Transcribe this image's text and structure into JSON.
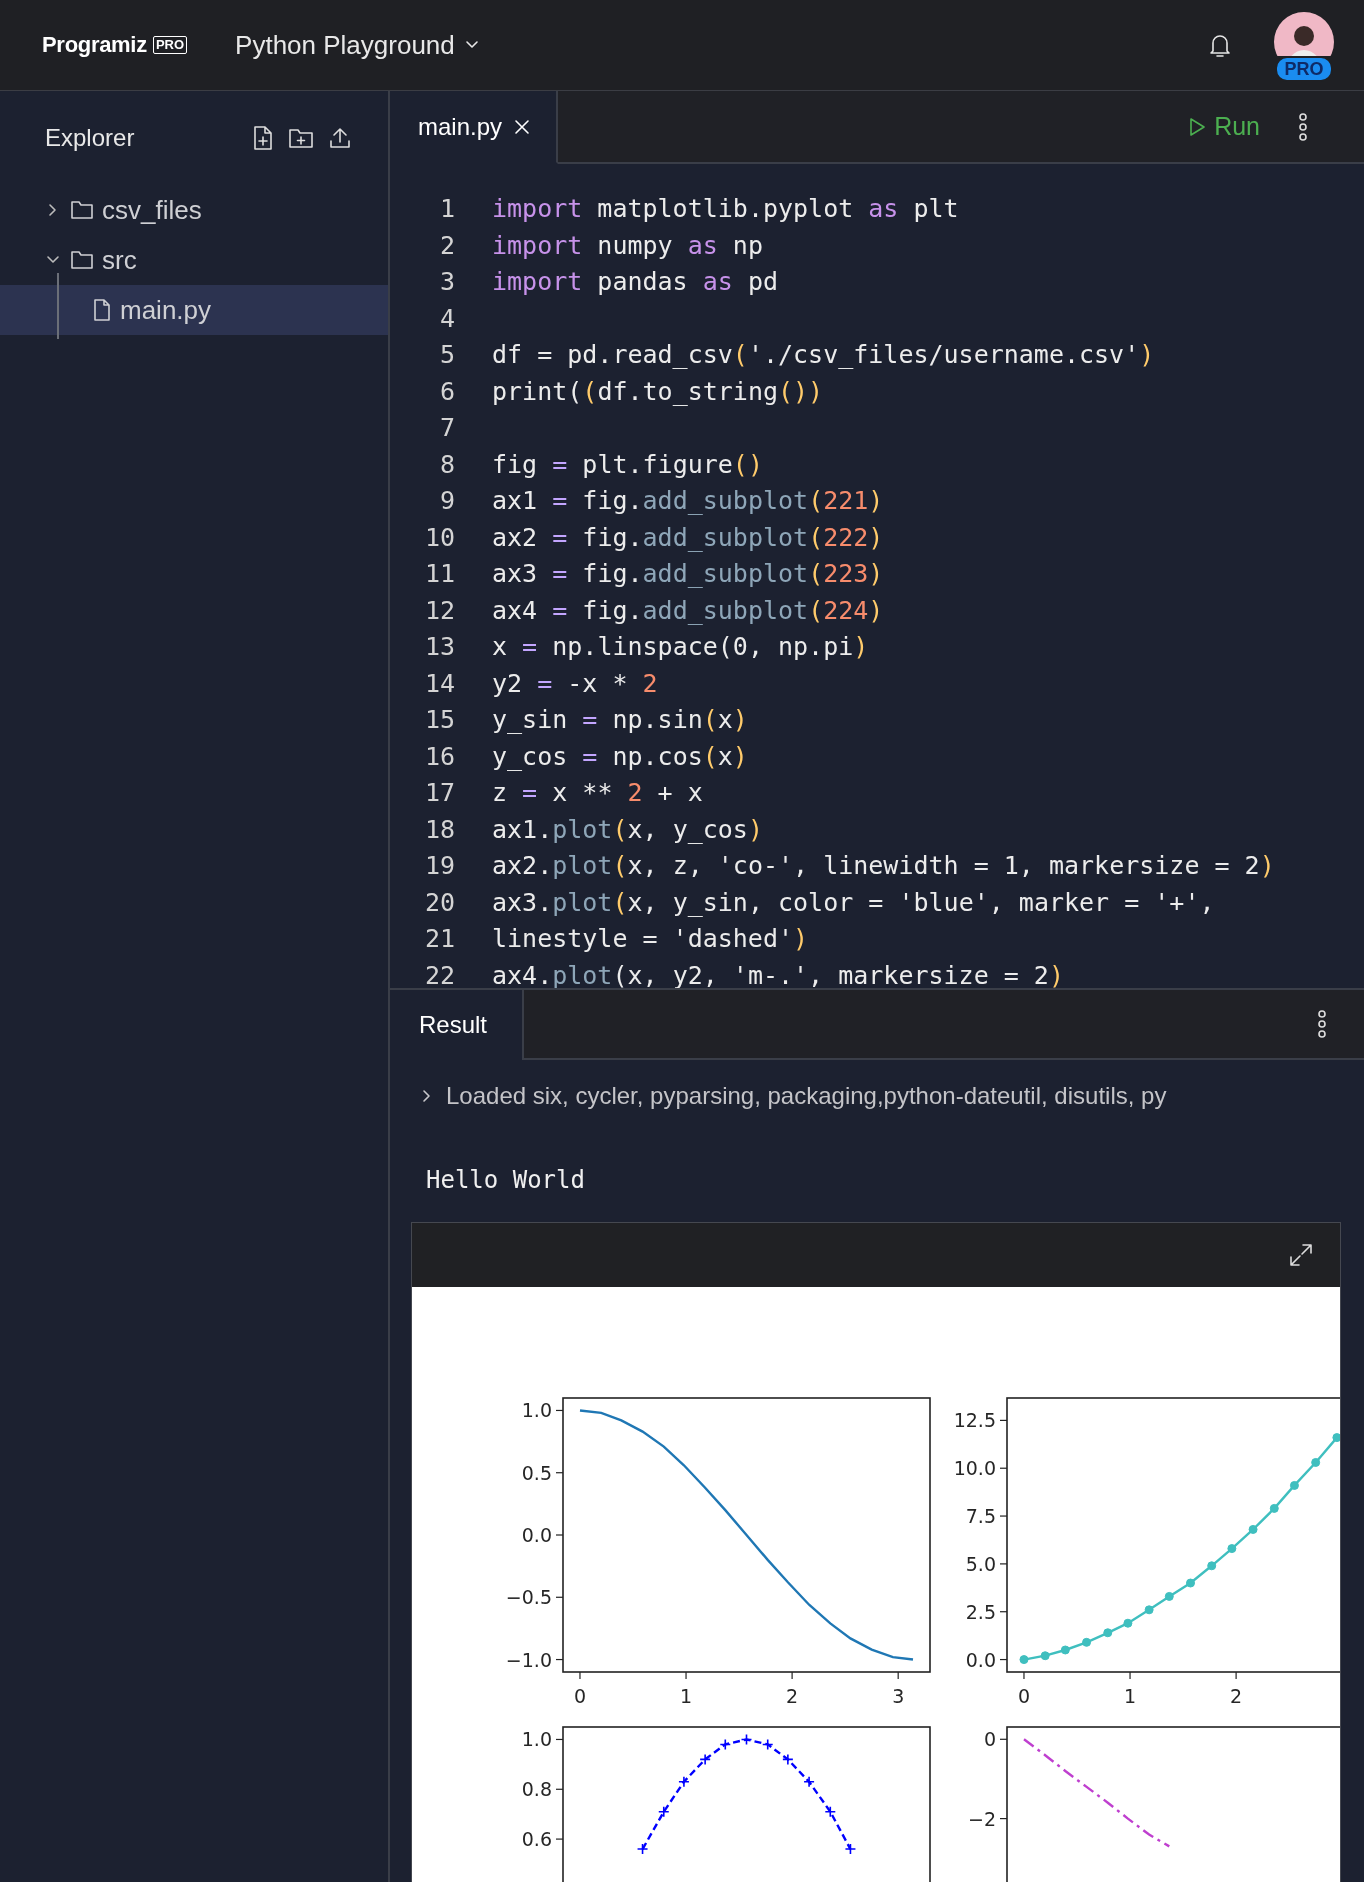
{
  "header": {
    "logo": "Programiz",
    "logo_badge": "PRO",
    "title": "Python Playground",
    "avatar_badge": "PRO"
  },
  "explorer": {
    "title": "Explorer",
    "tree": [
      {
        "name": "csv_files",
        "kind": "folder",
        "expanded": false,
        "selected": false
      },
      {
        "name": "src",
        "kind": "folder",
        "expanded": true,
        "selected": false,
        "children": [
          {
            "name": "main.py",
            "kind": "file",
            "selected": true
          }
        ]
      }
    ]
  },
  "editor": {
    "tabs": [
      {
        "label": "main.py",
        "selected": true
      }
    ],
    "run_label": "Run",
    "lines": [
      {
        "number": "1",
        "tokens": [
          {
            "kind": "kw",
            "text": "import"
          },
          {
            "kind": "plain",
            "text": " matplotlib.pyplot "
          },
          {
            "kind": "kw",
            "text": "as"
          },
          {
            "kind": "plain",
            "text": " plt"
          }
        ]
      },
      {
        "number": "2",
        "tokens": [
          {
            "kind": "kw",
            "text": "import"
          },
          {
            "kind": "plain",
            "text": " numpy "
          },
          {
            "kind": "kw",
            "text": "as"
          },
          {
            "kind": "plain",
            "text": " np"
          }
        ]
      },
      {
        "number": "3",
        "tokens": [
          {
            "kind": "kw",
            "text": "import"
          },
          {
            "kind": "plain",
            "text": " pandas "
          },
          {
            "kind": "kw",
            "text": "as"
          },
          {
            "kind": "plain",
            "text": " pd"
          }
        ]
      },
      {
        "number": "4"
      },
      {
        "number": "5",
        "tokens": [
          {
            "kind": "plain",
            "text": "df = pd.read_csv"
          },
          {
            "kind": "paren",
            "text": "("
          },
          {
            "kind": "plain",
            "text": "'./csv_files/username.csv'"
          },
          {
            "kind": "paren",
            "text": ")"
          }
        ]
      },
      {
        "number": "6",
        "tokens": [
          {
            "kind": "plain",
            "text": "print("
          },
          {
            "kind": "paren",
            "text": "("
          },
          {
            "kind": "plain",
            "text": "df.to_string"
          },
          {
            "kind": "paren",
            "text": "())"
          }
        ]
      },
      {
        "number": "7"
      },
      {
        "number": "8",
        "tokens": [
          {
            "kind": "plain",
            "text": "fig "
          },
          {
            "kind": "op",
            "text": "="
          },
          {
            "kind": "plain",
            "text": " plt.figure"
          },
          {
            "kind": "paren",
            "text": "()"
          }
        ]
      },
      {
        "number": "9",
        "tokens": [
          {
            "kind": "plain",
            "text": "ax1 "
          },
          {
            "kind": "op",
            "text": "="
          },
          {
            "kind": "plain",
            "text": " fig."
          },
          {
            "kind": "fn",
            "text": "add_subplot"
          },
          {
            "kind": "paren",
            "text": "("
          },
          {
            "kind": "num",
            "text": "221"
          },
          {
            "kind": "paren",
            "text": ")"
          }
        ]
      },
      {
        "number": "10",
        "tokens": [
          {
            "kind": "plain",
            "text": "ax2 "
          },
          {
            "kind": "op",
            "text": "="
          },
          {
            "kind": "plain",
            "text": " fig."
          },
          {
            "kind": "fn",
            "text": "add_subplot"
          },
          {
            "kind": "paren",
            "text": "("
          },
          {
            "kind": "num",
            "text": "222"
          },
          {
            "kind": "paren",
            "text": ")"
          }
        ]
      },
      {
        "number": "11",
        "tokens": [
          {
            "kind": "plain",
            "text": "ax3 "
          },
          {
            "kind": "op",
            "text": "="
          },
          {
            "kind": "plain",
            "text": " fig."
          },
          {
            "kind": "fn",
            "text": "add_subplot"
          },
          {
            "kind": "paren",
            "text": "("
          },
          {
            "kind": "num",
            "text": "223"
          },
          {
            "kind": "paren",
            "text": ")"
          }
        ]
      },
      {
        "number": "12",
        "tokens": [
          {
            "kind": "plain",
            "text": "ax4 "
          },
          {
            "kind": "op",
            "text": "="
          },
          {
            "kind": "plain",
            "text": " fig."
          },
          {
            "kind": "fn",
            "text": "add_subplot"
          },
          {
            "kind": "paren",
            "text": "("
          },
          {
            "kind": "num",
            "text": "224"
          },
          {
            "kind": "paren",
            "text": ")"
          }
        ]
      },
      {
        "number": "13",
        "tokens": [
          {
            "kind": "plain",
            "text": "x "
          },
          {
            "kind": "op",
            "text": "="
          },
          {
            "kind": "plain",
            "text": " np.linspace(0, np.pi"
          },
          {
            "kind": "paren",
            "text": ")"
          }
        ]
      },
      {
        "number": "14",
        "tokens": [
          {
            "kind": "plain",
            "text": "y2 "
          },
          {
            "kind": "op",
            "text": "="
          },
          {
            "kind": "plain",
            "text": " -x * "
          },
          {
            "kind": "num",
            "text": "2"
          }
        ]
      },
      {
        "number": "15",
        "tokens": [
          {
            "kind": "plain",
            "text": "y_sin "
          },
          {
            "kind": "op",
            "text": "="
          },
          {
            "kind": "plain",
            "text": " np.sin"
          },
          {
            "kind": "paren",
            "text": "("
          },
          {
            "kind": "plain",
            "text": "x"
          },
          {
            "kind": "paren",
            "text": ")"
          }
        ]
      },
      {
        "number": "16",
        "tokens": [
          {
            "kind": "plain",
            "text": "y_cos "
          },
          {
            "kind": "op",
            "text": "="
          },
          {
            "kind": "plain",
            "text": " np.cos"
          },
          {
            "kind": "paren",
            "text": "("
          },
          {
            "kind": "plain",
            "text": "x"
          },
          {
            "kind": "paren",
            "text": ")"
          }
        ]
      },
      {
        "number": "17",
        "tokens": [
          {
            "kind": "plain",
            "text": "z "
          },
          {
            "kind": "op",
            "text": "="
          },
          {
            "kind": "plain",
            "text": " x ** "
          },
          {
            "kind": "num",
            "text": "2"
          },
          {
            "kind": "plain",
            "text": " + x"
          }
        ]
      },
      {
        "number": "18",
        "tokens": [
          {
            "kind": "plain",
            "text": "ax1."
          },
          {
            "kind": "fn",
            "text": "plot"
          },
          {
            "kind": "paren",
            "text": "("
          },
          {
            "kind": "plain",
            "text": "x, y_cos"
          },
          {
            "kind": "paren",
            "text": ")"
          }
        ]
      },
      {
        "number": "19",
        "tokens": [
          {
            "kind": "plain",
            "text": "ax2."
          },
          {
            "kind": "fn",
            "text": "plot"
          },
          {
            "kind": "paren",
            "text": "("
          },
          {
            "kind": "plain",
            "text": "x, z, 'co-', linewidth = 1, markersize = 2"
          },
          {
            "kind": "paren",
            "text": ")"
          }
        ]
      },
      {
        "number": "20",
        "tokens": [
          {
            "kind": "plain",
            "text": "ax3."
          },
          {
            "kind": "fn",
            "text": "plot"
          },
          {
            "kind": "paren",
            "text": "("
          },
          {
            "kind": "plain",
            "text": "x, y_sin, color = 'blue', marker = '+',"
          }
        ]
      },
      {
        "number": "21",
        "tokens": [
          {
            "kind": "plain",
            "text": "linestyle = 'dashed'"
          },
          {
            "kind": "paren",
            "text": ")"
          }
        ]
      },
      {
        "number": "22",
        "tokens": [
          {
            "kind": "plain",
            "text": "ax4."
          },
          {
            "kind": "fn",
            "text": "plot"
          },
          {
            "kind": "plain",
            "text": "(x, y2, 'm-.', markersize = 2"
          },
          {
            "kind": "paren",
            "text": ")"
          }
        ]
      }
    ]
  },
  "result": {
    "tab": "Result",
    "log": "Loaded six, cycler, pyparsing, packaging,python-dateutil, disutils, py",
    "output": "Hello World",
    "plots": [
      {
        "chart_data": {
          "type": "line",
          "x": [
            0,
            0.2,
            0.39,
            0.59,
            0.79,
            0.98,
            1.18,
            1.37,
            1.57,
            1.77,
            1.96,
            2.16,
            2.36,
            2.55,
            2.75,
            2.95,
            3.14
          ],
          "series": [
            {
              "color": "#1f77b4",
              "line_style": "solid",
              "values": [
                1,
                0.98,
                0.92,
                0.83,
                0.71,
                0.56,
                0.38,
                0.2,
                0,
                -0.2,
                -0.38,
                -0.56,
                -0.71,
                -0.83,
                -0.92,
                -0.98,
                -1
              ]
            }
          ],
          "xlim": [
            -0.16,
            3.3
          ],
          "ylim": [
            -1.1,
            1.1
          ],
          "xticks": [
            0,
            1,
            2,
            3
          ],
          "yticks": [
            {
              "value": 1,
              "label": "1.0"
            },
            {
              "value": 0.5,
              "label": "0.5"
            },
            {
              "value": 0,
              "label": "0.0"
            },
            {
              "value": -0.5,
              "label": "−0.5"
            },
            {
              "value": -1,
              "label": "−1.0"
            }
          ]
        }
      },
      {
        "chart_data": {
          "type": "line",
          "x": [
            0,
            0.2,
            0.39,
            0.59,
            0.79,
            0.98,
            1.18,
            1.37,
            1.57,
            1.77,
            1.96,
            2.16,
            2.36,
            2.55,
            2.75,
            2.95
          ],
          "series": [
            {
              "color": "#3fbfbf",
              "line_style": "solid",
              "marker": "circle",
              "values": [
                0,
                0.2,
                0.5,
                0.9,
                1.4,
                1.9,
                2.6,
                3.3,
                4,
                4.9,
                5.8,
                6.8,
                7.9,
                9.1,
                10.3,
                11.6
              ]
            }
          ],
          "xlim": [
            -0.16,
            3.3
          ],
          "ylim": [
            -0.65,
            13.67
          ],
          "xticks": [
            0,
            1,
            2
          ],
          "yticks": [
            {
              "value": 12.5,
              "label": "12.5"
            },
            {
              "value": 10,
              "label": "10.0"
            },
            {
              "value": 7.5,
              "label": "7.5"
            },
            {
              "value": 5,
              "label": "5.0"
            },
            {
              "value": 2.5,
              "label": "2.5"
            },
            {
              "value": 0,
              "label": "0.0"
            }
          ]
        }
      },
      {
        "chart_data": {
          "type": "line",
          "x": [
            0.59,
            0.79,
            0.98,
            1.18,
            1.37,
            1.57,
            1.77,
            1.96,
            2.16,
            2.36,
            2.55
          ],
          "series": [
            {
              "color": "#0000ff",
              "line_style": "dashed",
              "marker": "cross",
              "values": [
                0.56,
                0.71,
                0.83,
                0.92,
                0.98,
                1,
                0.98,
                0.92,
                0.83,
                0.71,
                0.56
              ]
            }
          ],
          "xlim": [
            -0.16,
            3.3
          ],
          "ylim": [
            -0.05,
            1.05
          ],
          "yticks": [
            {
              "value": 1,
              "label": "1.0"
            },
            {
              "value": 0.8,
              "label": "0.8"
            },
            {
              "value": 0.6,
              "label": "0.6"
            }
          ]
        }
      },
      {
        "chart_data": {
          "type": "line",
          "x": [
            0,
            0.2,
            0.39,
            0.59,
            0.79,
            0.98,
            1.18,
            1.37
          ],
          "series": [
            {
              "color": "#bf3fcf",
              "line_style": "dashdot",
              "values": [
                0,
                -0.4,
                -0.8,
                -1.2,
                -1.6,
                -2,
                -2.4,
                -2.7
              ]
            }
          ],
          "xlim": [
            -0.16,
            3.3
          ],
          "ylim": [
            -6.6,
            0.31
          ],
          "yticks": [
            {
              "value": 0,
              "label": "0"
            },
            {
              "value": -2,
              "label": "−2"
            }
          ]
        }
      }
    ]
  }
}
